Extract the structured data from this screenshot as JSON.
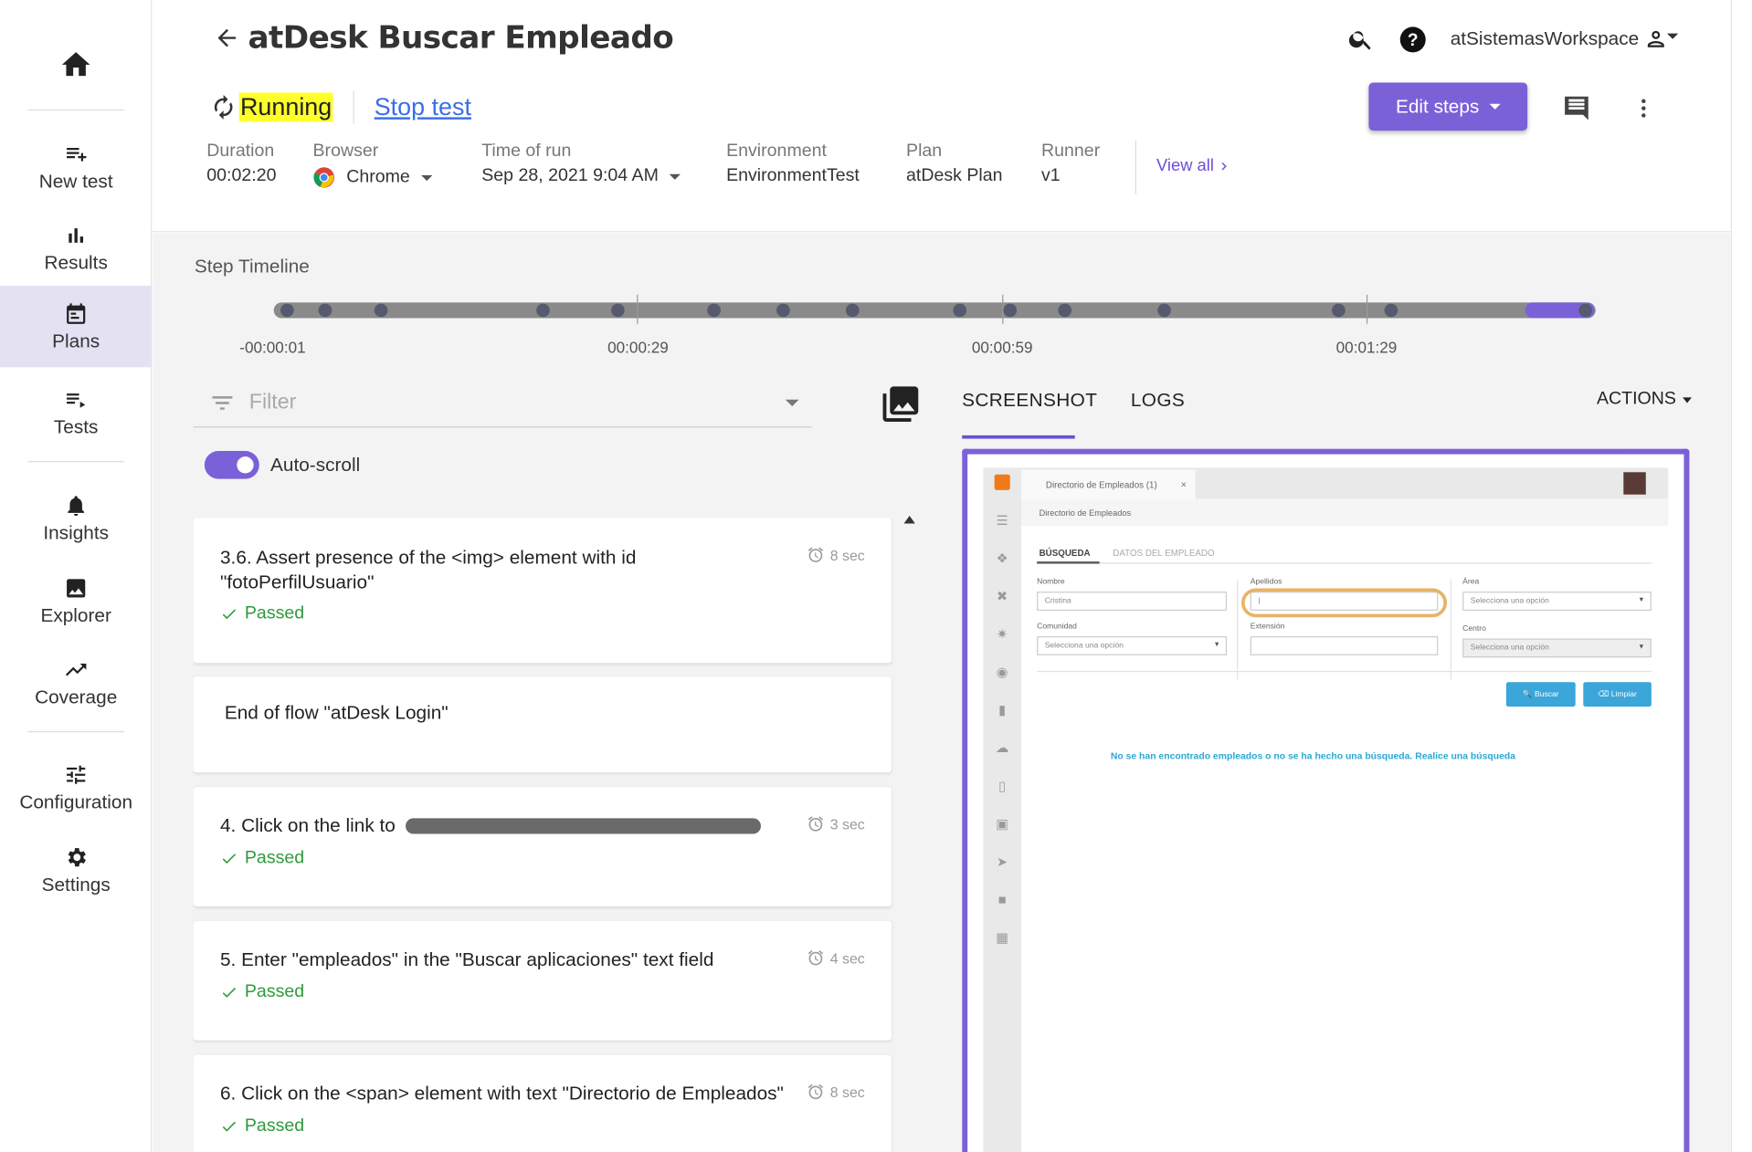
{
  "sidebar": {
    "items": [
      {
        "label": "New test",
        "icon": "playlist-add-icon"
      },
      {
        "label": "Results",
        "icon": "bar-chart-icon"
      },
      {
        "label": "Plans",
        "icon": "calendar-icon",
        "active": true
      },
      {
        "label": "Tests",
        "icon": "playlist-play-icon"
      },
      {
        "label": "Insights",
        "icon": "bell-icon"
      },
      {
        "label": "Explorer",
        "icon": "image-icon"
      },
      {
        "label": "Coverage",
        "icon": "trending-up-icon"
      },
      {
        "label": "Configuration",
        "icon": "tune-icon"
      },
      {
        "label": "Settings",
        "icon": "gear-icon"
      }
    ]
  },
  "header": {
    "title": "atDesk Buscar Empleado",
    "workspace": "atSistemasWorkspace",
    "status": "Running",
    "stop_label": "Stop test",
    "edit_steps_label": "Edit steps",
    "meta": {
      "duration_label": "Duration",
      "duration": "00:02:20",
      "browser_label": "Browser",
      "browser": "Chrome",
      "time_label": "Time of run",
      "time": "Sep 28, 2021 9:04 AM",
      "env_label": "Environment",
      "env": "EnvironmentTest",
      "plan_label": "Plan",
      "plan": "atDesk Plan",
      "runner_label": "Runner",
      "runner": "v1",
      "view_all": "View all"
    }
  },
  "timeline": {
    "title": "Step Timeline",
    "labels": [
      "-00:00:01",
      "00:00:29",
      "00:00:59",
      "00:01:29"
    ],
    "progress": 0.95
  },
  "steps_panel": {
    "filter_placeholder": "Filter",
    "autoscroll_label": "Auto-scroll",
    "autoscroll_on": true,
    "steps": [
      {
        "text": "3.6. Assert presence of the <img> element with id \"fotoPerfilUsuario\"",
        "status": "Passed",
        "time": "8 sec"
      },
      {
        "text": "End of flow \"atDesk Login\""
      },
      {
        "text": "4. Click on the link to",
        "status": "Passed",
        "time": "3 sec"
      },
      {
        "text": "5. Enter \"empleados\" in the \"Buscar aplicaciones\" text field",
        "status": "Passed",
        "time": "4 sec"
      },
      {
        "text": "6. Click on the <span> element with text \"Directorio de Empleados\"",
        "status": "Passed",
        "time": "8 sec"
      }
    ]
  },
  "right_panel": {
    "tabs": [
      "SCREENSHOT",
      "LOGS"
    ],
    "active_tab": "SCREENSHOT",
    "actions_label": "ACTIONS"
  },
  "screenshot": {
    "tab_title": "Directorio de Empleados (1)",
    "breadcrumb": "Directorio de Empleados",
    "tab_search": "BÚSQUEDA",
    "tab_details": "DATOS DEL EMPLEADO",
    "fields": {
      "nombre_label": "Nombre",
      "nombre_value": "Cristina",
      "apellidos_label": "Apellidos",
      "apellidos_value": "|",
      "area_label": "Área",
      "area_value": "Selecciona una opción",
      "comunidad_label": "Comunidad",
      "comunidad_value": "Selecciona una opción",
      "extension_label": "Extensión",
      "centro_label": "Centro",
      "centro_value": "Selecciona una opción"
    },
    "buscar_label": "Buscar",
    "limpiar_label": "Limpiar",
    "message": "No se han encontrado empleados o no se ha hecho una búsqueda. Realice una búsqueda"
  }
}
